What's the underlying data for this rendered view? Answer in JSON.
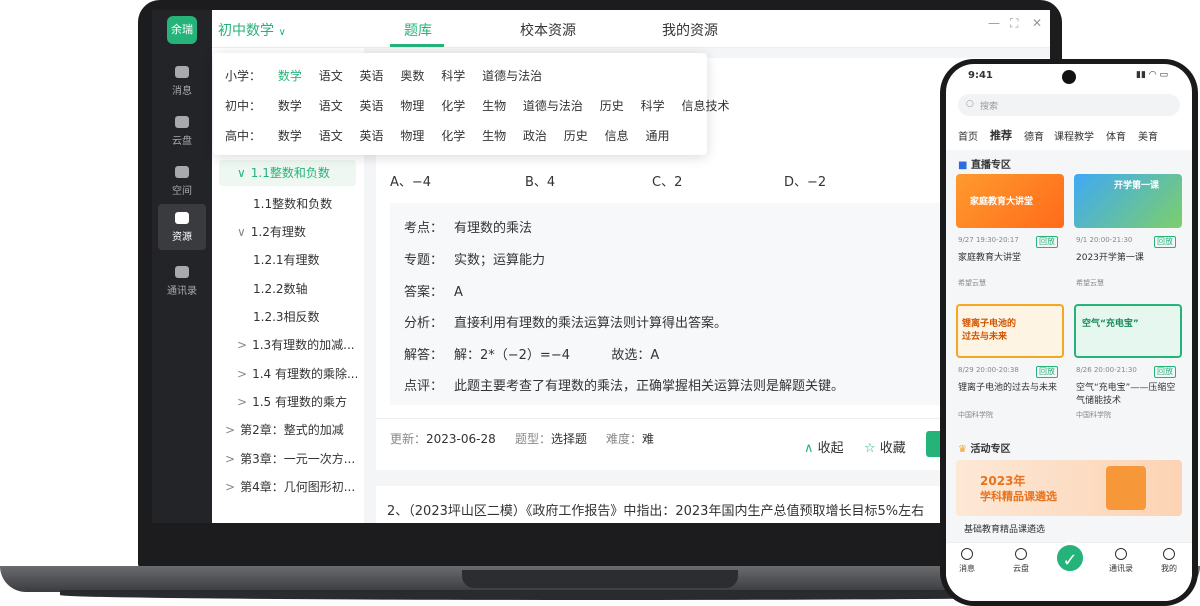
{
  "sidebar": {
    "logo": "余瑞",
    "items": [
      {
        "label": "消息",
        "icon": "message-icon"
      },
      {
        "label": "云盘",
        "icon": "cloud-icon"
      },
      {
        "label": "空间",
        "icon": "grid-icon"
      },
      {
        "label": "资源",
        "icon": "folder-icon",
        "active": true
      },
      {
        "label": "通讯录",
        "icon": "contacts-icon"
      }
    ]
  },
  "topbar": {
    "subject": "初中数学",
    "tabs": [
      "题库",
      "校本资源",
      "我的资源"
    ],
    "window_controls": [
      "—",
      "⛶",
      "✕"
    ]
  },
  "dropdown": {
    "rows": [
      {
        "level": "小学：",
        "subjects": [
          "数学",
          "语文",
          "英语",
          "奥数",
          "科学",
          "道德与法治"
        ],
        "selected": "数学"
      },
      {
        "level": "初中：",
        "subjects": [
          "数学",
          "语文",
          "英语",
          "物理",
          "化学",
          "生物",
          "道德与法治",
          "历史",
          "科学",
          "信息技术"
        ]
      },
      {
        "level": "高中：",
        "subjects": [
          "数学",
          "语文",
          "英语",
          "物理",
          "化学",
          "生物",
          "政治",
          "历史",
          "信息",
          "通用"
        ]
      }
    ]
  },
  "tree": {
    "items": [
      {
        "label": "1.1整数和负数",
        "arrow": "∨",
        "active": true
      },
      {
        "label": "1.1整数和负数"
      },
      {
        "label": "1.2有理数",
        "arrow": "∨"
      },
      {
        "label": "1.2.1有理数"
      },
      {
        "label": "1.2.2数轴"
      },
      {
        "label": "1.2.3相反数"
      },
      {
        "label": "1.3有理数的加减...",
        "arrow": ">"
      },
      {
        "label": "1.4 有理数的乘除...",
        "arrow": ">"
      },
      {
        "label": "1.5 有理数的乘方",
        "arrow": ">"
      },
      {
        "label": "第2章：整式的加减",
        "arrow": ">"
      },
      {
        "label": "第3章：一元一次方...",
        "arrow": ">"
      },
      {
        "label": "第4章：几何图形初...",
        "arrow": ">"
      }
    ]
  },
  "question": {
    "options": [
      "A、−4",
      "B、4",
      "C、2",
      "D、−2"
    ],
    "analysis": [
      {
        "label": "考点：",
        "value": "有理数的乘法"
      },
      {
        "label": "专题：",
        "value": "实数；运算能力"
      },
      {
        "label": "答案：",
        "value": "A"
      },
      {
        "label": "分析：",
        "value": "直接利用有理数的乘法运算法则计算得出答案。"
      },
      {
        "label": "解答：",
        "value": "解：2*（−2）=−4          故选：A"
      },
      {
        "label": "点评：",
        "value": "此题主要考查了有理数的乘法，正确掌握相关运算法则是解题关键。"
      }
    ],
    "meta": {
      "updated_label": "更新：",
      "updated": "2023-06-28",
      "type_label": "题型：",
      "type": "选择题",
      "difficulty_label": "难度：",
      "difficulty": "难"
    },
    "actions": {
      "collapse": "收起",
      "favorite": "收藏"
    }
  },
  "question2": {
    "text": "2、（2023坪山区二模）《政府工作报告》中指出：2023年国内生产总值预取增长目标5%左右"
  },
  "phone": {
    "time": "9:41",
    "search_placeholder": "搜索",
    "tabs": [
      "首页",
      "推荐",
      "德育",
      "课程教学",
      "体育",
      "美育"
    ],
    "live_section": "直播专区",
    "cards": [
      {
        "time": "9/27 19:30-20:17",
        "badge": "回放",
        "title": "家庭教育大讲堂",
        "source": "希望云慧",
        "img_text": "家庭教育大讲堂"
      },
      {
        "time": "9/1 20:00-21:30",
        "badge": "回放",
        "title": "2023开学第一课",
        "source": "希望云慧",
        "img_text": "开学第一课"
      },
      {
        "time": "8/29 20:00-20:38",
        "badge": "回放",
        "title": "锂离子电池的过去与未来",
        "source": "中国科学院",
        "img_text": "锂离子电池的过去与未来"
      },
      {
        "time": "8/26 20:00-21:30",
        "badge": "回放",
        "title": "空气“充电宝”——压缩空气储能技术",
        "source": "中国科学院",
        "img_text": "空气“充电宝”"
      }
    ],
    "activity_section": "活动专区",
    "banner_title": "2023年",
    "banner_sub": "学科精品课遴选",
    "banner_caption": "基础教育精品课遴选",
    "bottom_nav": [
      "消息",
      "云盘",
      "通讯录",
      "我的"
    ]
  },
  "colors": {
    "accent": "#25b37a",
    "sidebar": "#232428"
  }
}
